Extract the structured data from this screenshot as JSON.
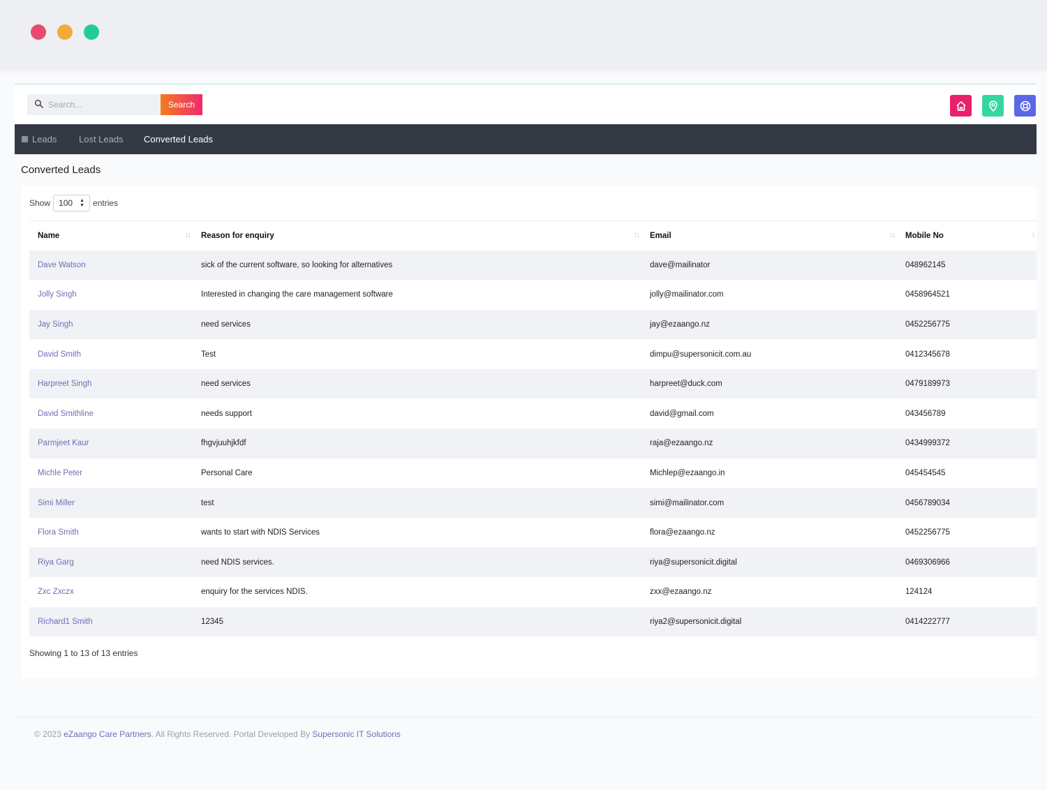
{
  "window": {
    "controls": [
      "close",
      "minimize",
      "maximize"
    ]
  },
  "topbar": {
    "search_placeholder": "Search...",
    "search_button": "Search",
    "icons": [
      "home-icon",
      "location-pin-icon",
      "help-lifebuoy-icon"
    ]
  },
  "nav": {
    "items": [
      {
        "label": "Leads"
      },
      {
        "label": "Lost Leads"
      },
      {
        "label": "Converted Leads"
      }
    ],
    "active": "Converted Leads"
  },
  "page": {
    "title": "Converted Leads"
  },
  "table": {
    "show_label": "Show",
    "entries_value": "100",
    "entries_label": "entries",
    "columns": [
      "Name",
      "Reason for enquiry",
      "Email",
      "Mobile No"
    ],
    "rows": [
      {
        "name": "Dave Watson",
        "reason": "sick of the current software, so looking for alternatives",
        "email": "dave@mailinator",
        "mobile": "048962145"
      },
      {
        "name": "Jolly Singh",
        "reason": "Interested in changing the care management software",
        "email": "jolly@mailinator.com",
        "mobile": "0458964521"
      },
      {
        "name": "Jay Singh",
        "reason": "need services",
        "email": "jay@ezaango.nz",
        "mobile": "0452256775"
      },
      {
        "name": "David Smith",
        "reason": "Test",
        "email": "dimpu@supersonicit.com.au",
        "mobile": "0412345678"
      },
      {
        "name": "Harpreet Singh",
        "reason": "need services",
        "email": "harpreet@duck.com",
        "mobile": "0479189973"
      },
      {
        "name": "David Smithline",
        "reason": "needs support",
        "email": "david@gmail.com",
        "mobile": "043456789"
      },
      {
        "name": "Parmjeet Kaur",
        "reason": "fhgvjuuhjkfdf",
        "email": "raja@ezaango.nz",
        "mobile": "0434999372"
      },
      {
        "name": "Michle Peter",
        "reason": "Personal Care",
        "email": "Michlep@ezaango.in",
        "mobile": "045454545"
      },
      {
        "name": "Simi Miller",
        "reason": "test",
        "email": "simi@mailinator.com",
        "mobile": "0456789034"
      },
      {
        "name": "Flora Smith",
        "reason": "wants to start with NDIS Services",
        "email": "flora@ezaango.nz",
        "mobile": "0452256775"
      },
      {
        "name": "Riya Garg",
        "reason": "need NDIS services.",
        "email": "riya@supersonicit.digital",
        "mobile": "0469306966"
      },
      {
        "name": "Zxc Zxczx",
        "reason": "enquiry for the services NDIS.",
        "email": "zxx@ezaango.nz",
        "mobile": "124124"
      },
      {
        "name": "Richard1 Smith",
        "reason": "12345",
        "email": "riya2@supersonicit.digital",
        "mobile": "0414222777"
      }
    ],
    "summary": "Showing 1 to 13 of 13 entries"
  },
  "footer": {
    "prefix": "© 2023 ",
    "company": "eZaango Care Partners",
    "middle": ". All Rights Reserved. Portal Developed By ",
    "developer": "Supersonic IT Solutions"
  },
  "colors": {
    "nav_bg": "#343a44",
    "home_button": "#e8216b",
    "location_button": "#35d6a0",
    "help_button": "#5a67e6",
    "search_gradient_start": "#f57c1f",
    "search_gradient_end": "#ee2a6f",
    "name_link": "#6d6fb0"
  }
}
